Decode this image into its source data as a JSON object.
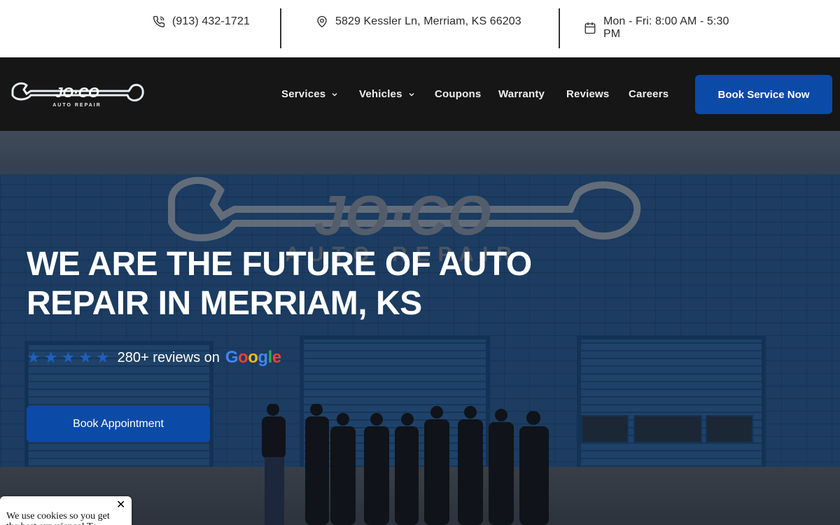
{
  "topbar": {
    "phone": "(913) 432-1721",
    "address": "5829 Kessler Ln, Merriam, KS 66203",
    "hours": "Mon - Fri: 8:00 AM - 5:30 PM",
    "icons": [
      "phone-icon",
      "map-pin-icon",
      "calendar-icon"
    ]
  },
  "nav": {
    "logo_text": "JO·CO",
    "logo_subtext": "AUTO REPAIR",
    "items": [
      {
        "label": "Services",
        "has_dropdown": true
      },
      {
        "label": "Vehicles",
        "has_dropdown": true
      },
      {
        "label": "Coupons",
        "has_dropdown": false
      },
      {
        "label": "Warranty",
        "has_dropdown": false
      },
      {
        "label": "Reviews",
        "has_dropdown": false
      },
      {
        "label": "Careers",
        "has_dropdown": false
      }
    ],
    "cta": "Book Service Now"
  },
  "hero": {
    "title": "WE ARE THE FUTURE OF AUTO REPAIR IN MERRIAM, KS",
    "rating_stars": 5,
    "reviews_text": "280+ reviews on",
    "reviews_brand": "Google",
    "cta": "Book Appointment",
    "sign_text": "JO·CO",
    "sign_subtext": "AUTO REPAIR"
  },
  "cookie": {
    "text": "We use cookies so you get the best experience! To",
    "close": "✕"
  },
  "colors": {
    "primary": "#0c4aa8",
    "nav_bg": "#161616",
    "star": "#1f5fbf"
  }
}
